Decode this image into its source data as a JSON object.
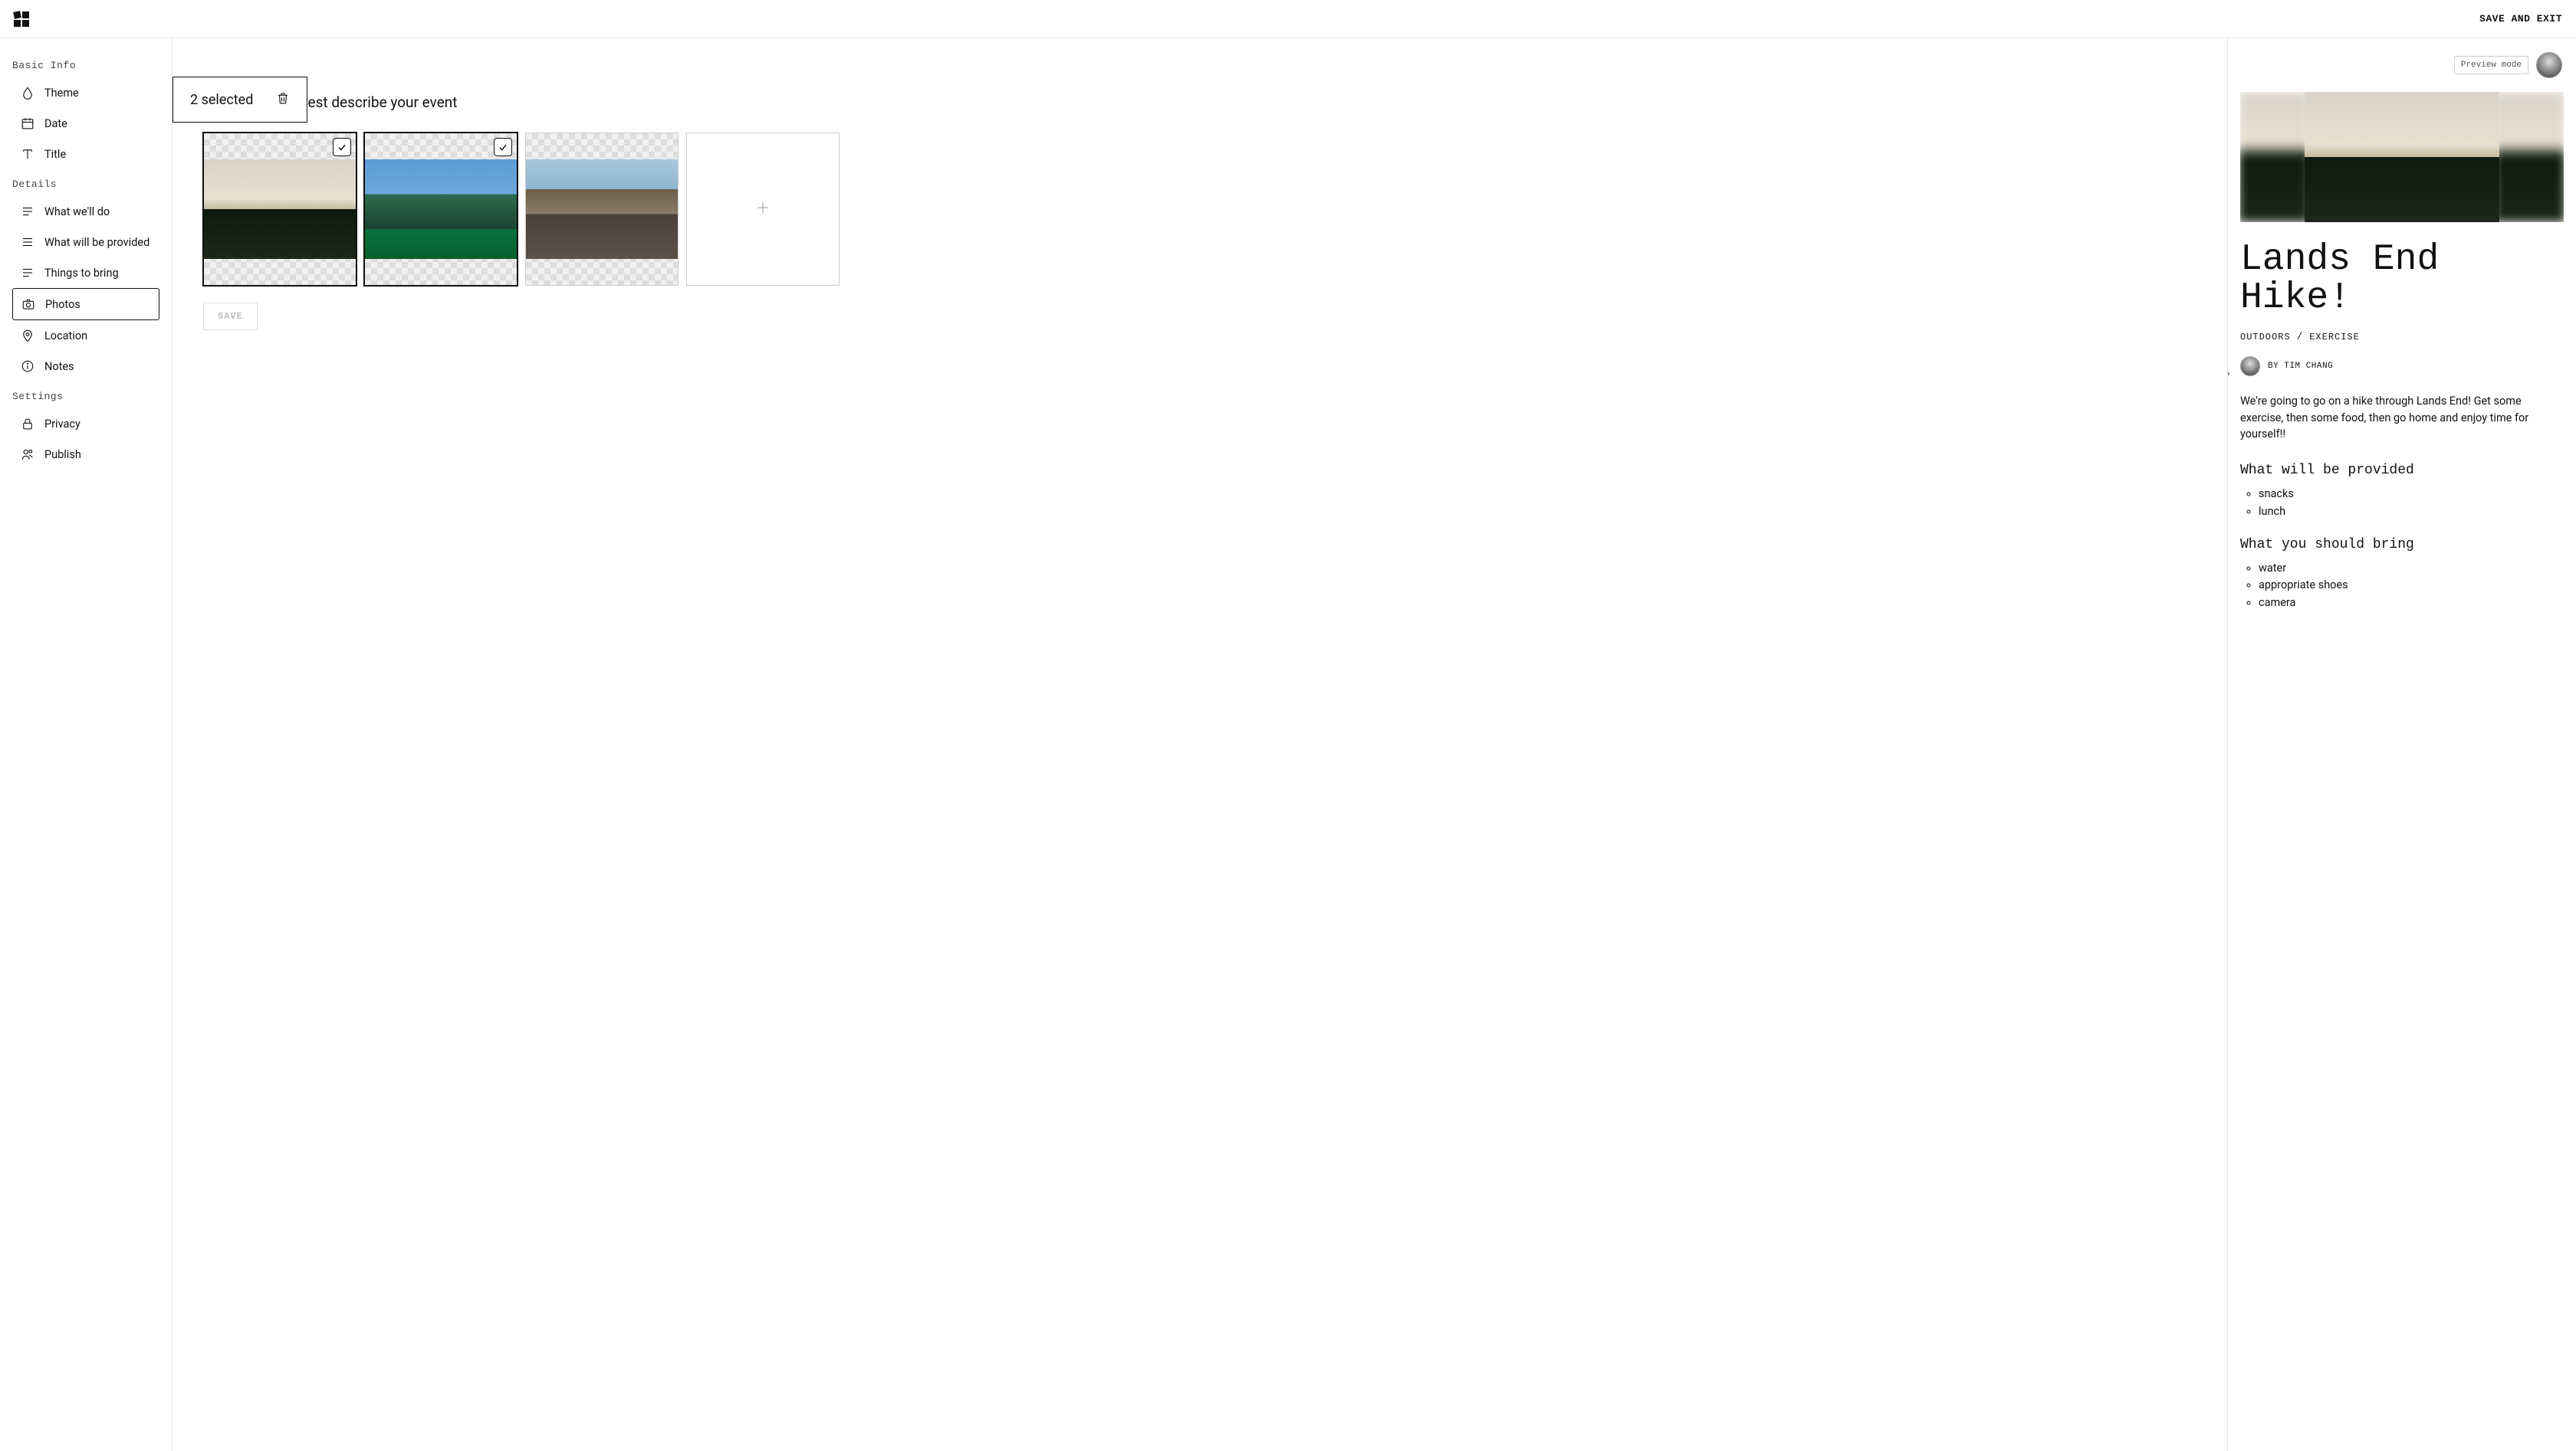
{
  "topbar": {
    "save_and_exit": "SAVE AND EXIT"
  },
  "sidebar": {
    "sections": {
      "basic": "Basic Info",
      "details": "Details",
      "settings": "Settings"
    },
    "items": {
      "theme": "Theme",
      "date": "Date",
      "title": "Title",
      "what_well_do": "What we'll do",
      "what_provided": "What will be provided",
      "things_to_bring": "Things to bring",
      "photos": "Photos",
      "location": "Location",
      "notes": "Notes",
      "privacy": "Privacy",
      "publish": "Publish"
    }
  },
  "main": {
    "selection_count": "2 selected",
    "heading_partial": "ity photos that best describe your event",
    "save_button": "SAVE",
    "photos": [
      {
        "selected": true
      },
      {
        "selected": true
      },
      {
        "selected": false
      }
    ]
  },
  "preview": {
    "badge": "Preview mode",
    "title": "Lands End Hike!",
    "tags": "OUTDOORS / EXERCISE",
    "byline": "BY TIM CHANG",
    "description": "We're going to go on a hike through Lands End! Get some exercise, then some food, then go home and enjoy time for yourself!!",
    "provided_heading": "What will be provided",
    "provided_items": [
      "snacks",
      "lunch"
    ],
    "bring_heading": "What you should bring",
    "bring_items": [
      "water",
      "appropriate shoes",
      "camera"
    ]
  }
}
